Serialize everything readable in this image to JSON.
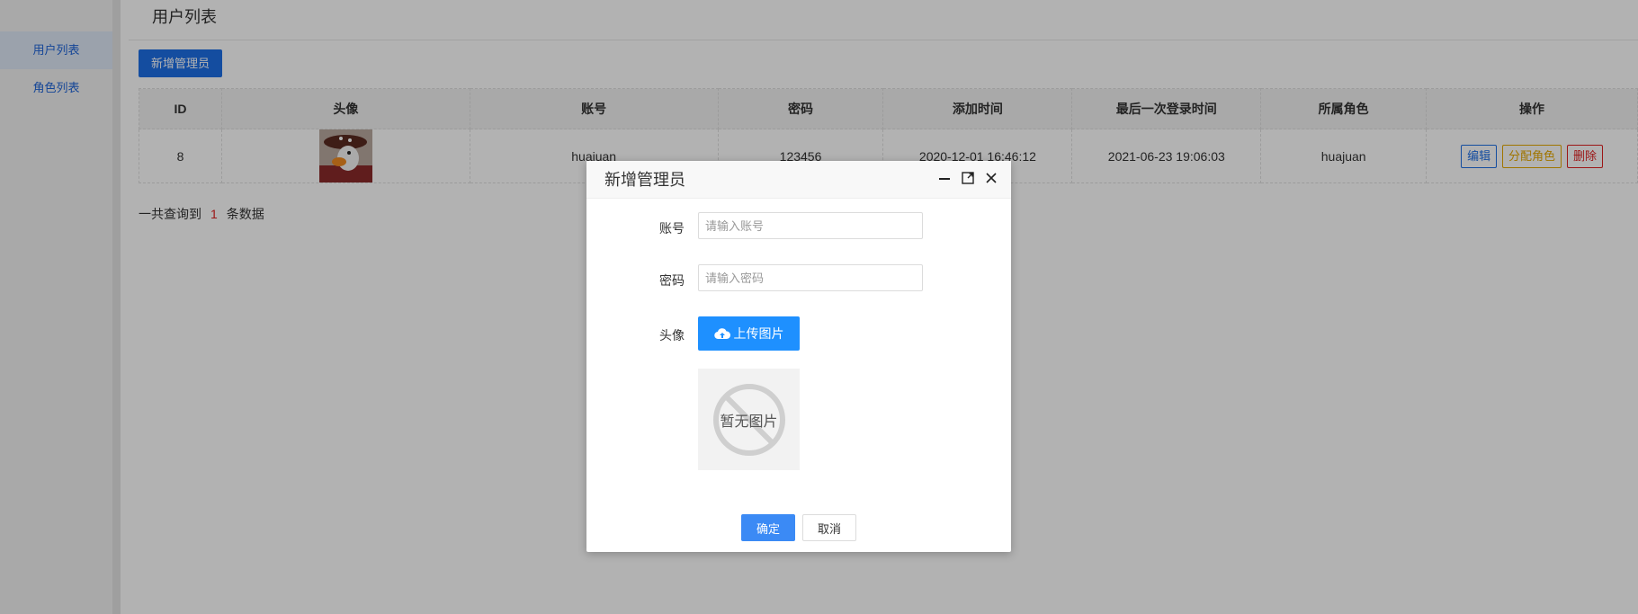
{
  "sidebar": {
    "items": [
      {
        "label": "用户列表",
        "active": true
      },
      {
        "label": "角色列表",
        "active": false
      }
    ]
  },
  "main": {
    "title": "用户列表",
    "add_button": "新增管理员",
    "table": {
      "headers": [
        "ID",
        "头像",
        "账号",
        "密码",
        "添加时间",
        "最后一次登录时间",
        "所属角色",
        "操作"
      ],
      "rows": [
        {
          "id": "8",
          "account": "huajuan",
          "password": "123456",
          "added": "2020-12-01 16:46:12",
          "last_login": "2021-06-23 19:06:03",
          "role": "huajuan",
          "actions": {
            "edit": "编辑",
            "assign_role": "分配角色",
            "delete": "删除"
          }
        }
      ]
    },
    "summary": {
      "prefix": "一共查询到",
      "count": "1",
      "suffix": "条数据"
    }
  },
  "modal": {
    "title": "新增管理员",
    "account_label": "账号",
    "account_placeholder": "请输入账号",
    "account_value": "",
    "password_label": "密码",
    "password_placeholder": "请输入密码",
    "password_value": "",
    "avatar_label": "头像",
    "upload_label": "上传图片",
    "no_image_text": "暂无图片",
    "ok_label": "确定",
    "cancel_label": "取消"
  },
  "colors": {
    "primary": "#1e6fe6",
    "upload": "#1e90ff",
    "warning": "#e6a800",
    "danger": "#e02020"
  }
}
